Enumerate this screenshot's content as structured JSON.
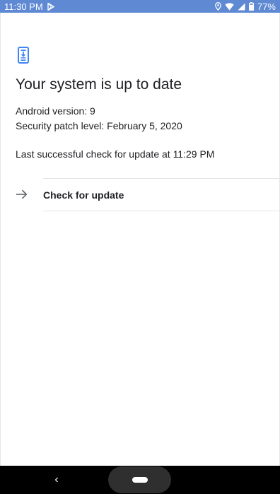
{
  "status_bar": {
    "time": "11:30 PM",
    "battery_percent": "77%",
    "background_color": "#5f89d3",
    "left_icons": [
      "play-store-icon"
    ],
    "right_icons": [
      "location-icon",
      "wifi-icon",
      "signal-icon",
      "battery-icon"
    ]
  },
  "main": {
    "header_icon": "system-update-icon",
    "accent_color": "#4285f4",
    "title": "Your system is up to date",
    "android_version": "Android version: 9",
    "security_patch": "Security patch level: February 5, 2020",
    "last_check": "Last successful check for update at 11:29 PM",
    "check_button": {
      "icon": "arrow-right-icon",
      "label": "Check for update"
    }
  },
  "nav_bar": {
    "back_glyph": "‹",
    "home": "home-pill"
  }
}
